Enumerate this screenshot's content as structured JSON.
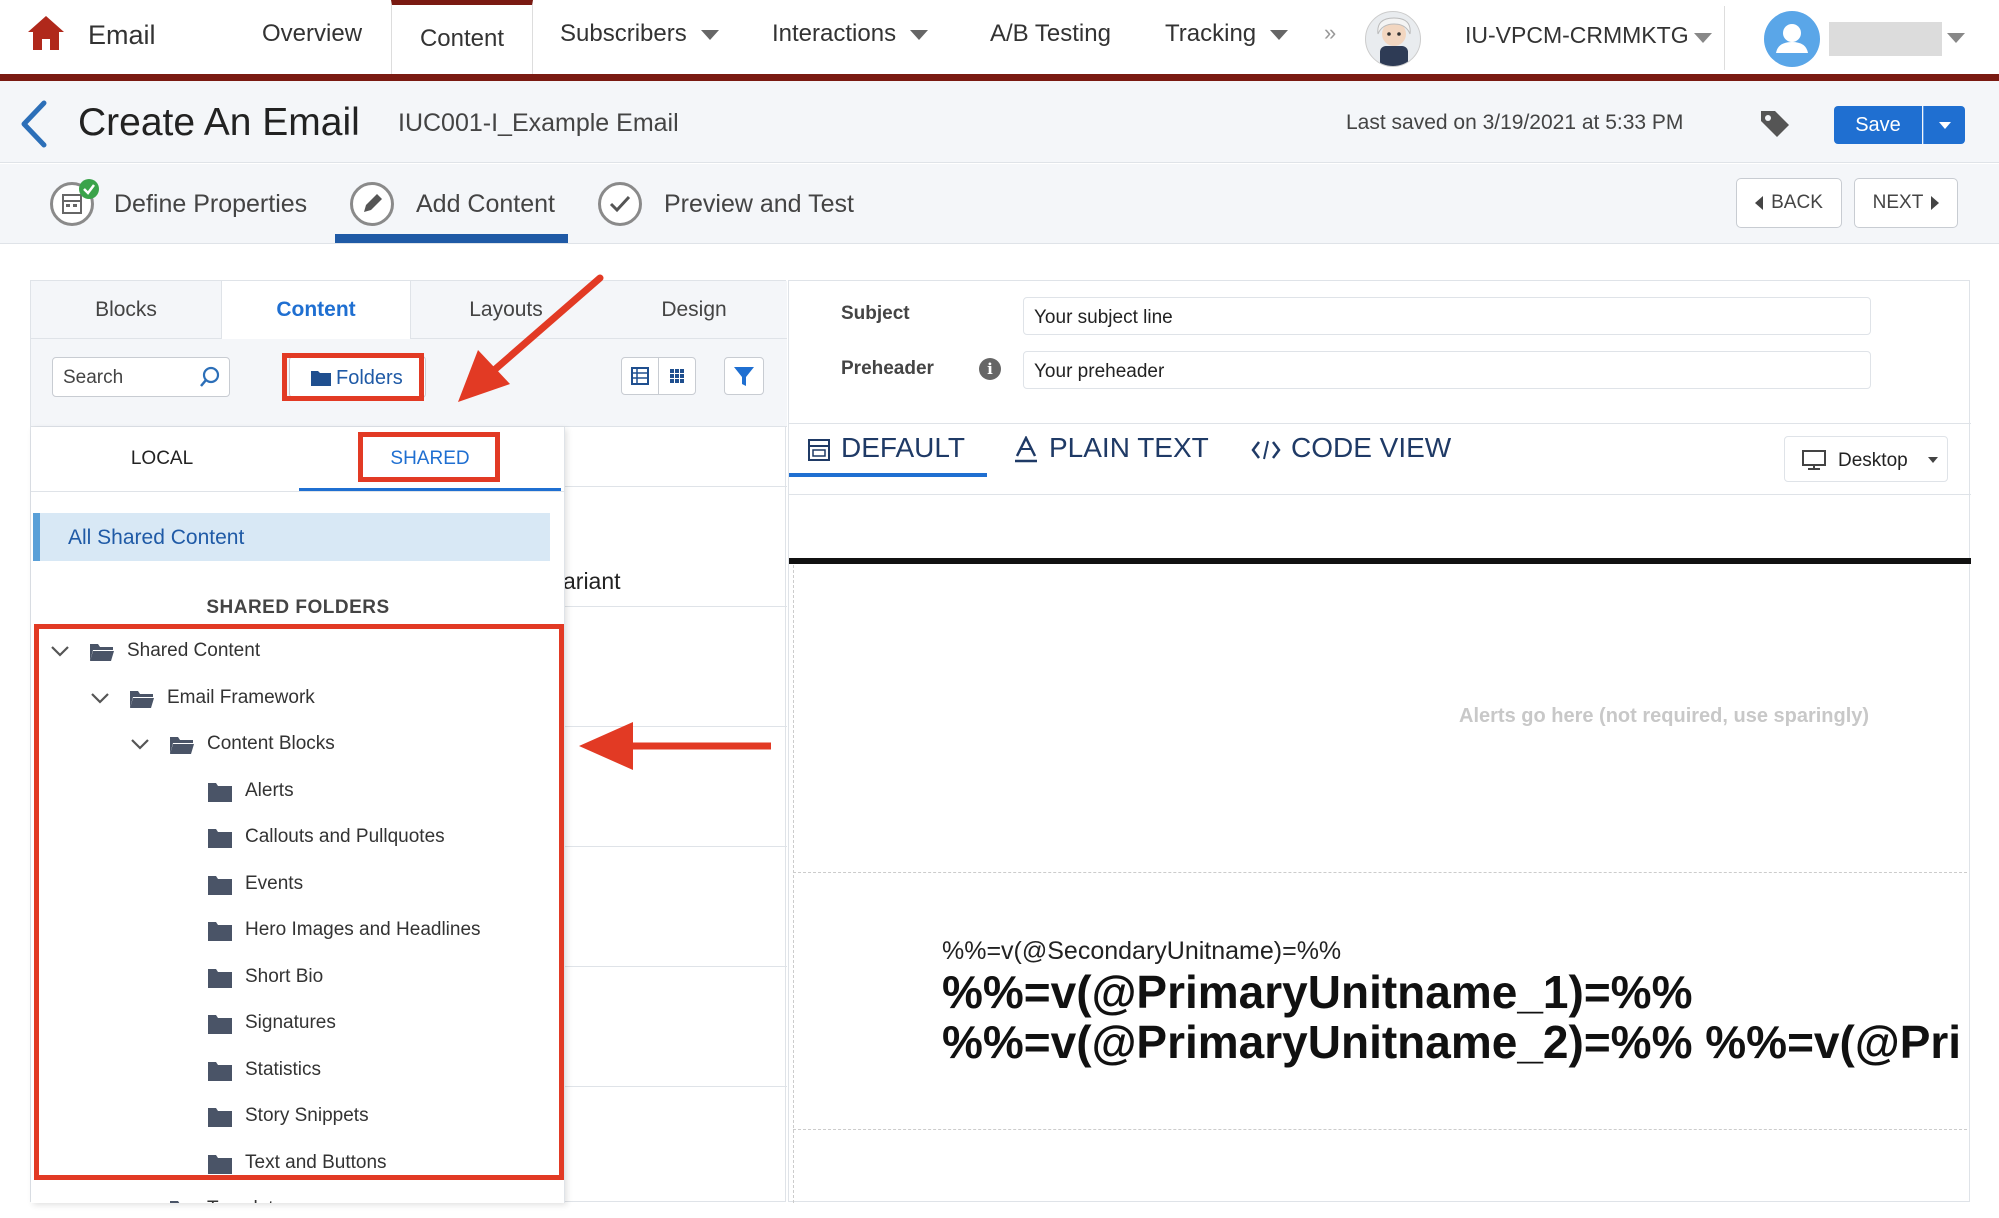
{
  "nav": {
    "app_name": "Email",
    "tabs": [
      {
        "label": "Overview",
        "has_menu": false
      },
      {
        "label": "Content",
        "has_menu": false,
        "active": true
      },
      {
        "label": "Subscribers",
        "has_menu": true
      },
      {
        "label": "Interactions",
        "has_menu": true
      },
      {
        "label": "A/B Testing",
        "has_menu": false
      },
      {
        "label": "Tracking",
        "has_menu": true
      }
    ],
    "more": "»",
    "business_unit": "IU-VPCM-CRMMKTG",
    "accent_color": "#7a1a12"
  },
  "header": {
    "title": "Create An Email",
    "email_name": "IUC001-I_Example Email",
    "last_saved": "Last saved on 3/19/2021 at 5:33 PM",
    "save_label": "Save"
  },
  "steps": {
    "items": [
      {
        "label": "Define Properties",
        "state": "complete"
      },
      {
        "label": "Add Content",
        "state": "active"
      },
      {
        "label": "Preview and Test",
        "state": "pending"
      }
    ],
    "back_label": "BACK",
    "next_label": "NEXT"
  },
  "left_panel": {
    "tabs": [
      "Blocks",
      "Content",
      "Layouts",
      "Design"
    ],
    "active_tab": "Content",
    "search_placeholder": "Search",
    "folders_label": "Folders",
    "behind_text": "ariant",
    "popover": {
      "tabs": [
        "LOCAL",
        "SHARED"
      ],
      "active_tab": "SHARED",
      "all_shared": "All Shared Content",
      "section_header": "SHARED FOLDERS",
      "tree": [
        {
          "label": "Shared Content",
          "level": 0,
          "expanded": true
        },
        {
          "label": "Email Framework",
          "level": 1,
          "expanded": true
        },
        {
          "label": "Content Blocks",
          "level": 2,
          "expanded": true
        },
        {
          "label": "Alerts",
          "level": 3
        },
        {
          "label": "Callouts and Pullquotes",
          "level": 3
        },
        {
          "label": "Events",
          "level": 3
        },
        {
          "label": "Hero Images and Headlines",
          "level": 3
        },
        {
          "label": "Short Bio",
          "level": 3
        },
        {
          "label": "Signatures",
          "level": 3
        },
        {
          "label": "Statistics",
          "level": 3
        },
        {
          "label": "Story Snippets",
          "level": 3
        },
        {
          "label": "Text and Buttons",
          "level": 3
        },
        {
          "label": "Template",
          "level": 2
        }
      ]
    }
  },
  "right_panel": {
    "subject_label": "Subject",
    "subject_value": "Your subject line",
    "preheader_label": "Preheader",
    "preheader_value": "Your preheader",
    "view_tabs": [
      "DEFAULT",
      "PLAIN TEXT",
      "CODE VIEW"
    ],
    "active_view": "DEFAULT",
    "device_label": "Desktop",
    "alerts_placeholder": "Alerts go here (not required, use sparingly)",
    "secondary_unit": "%%=v(@SecondaryUnitname)=%%",
    "primary_line_1": "%%=v(@PrimaryUnitname_1)=%%",
    "primary_line_2": "%%=v(@PrimaryUnitname_2)=%% %%=v(@Pri"
  },
  "annotation_color": "#e23a24",
  "primary_color": "#1f6fd1"
}
